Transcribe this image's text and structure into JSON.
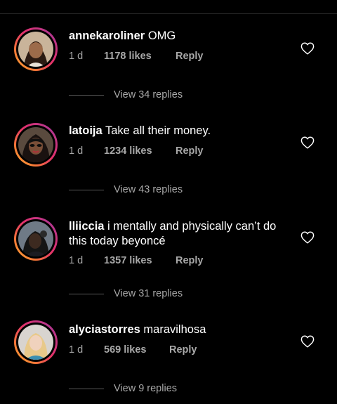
{
  "comments": [
    {
      "username": "annekaroliner",
      "text": "OMG",
      "time": "1 d",
      "likes": "1178 likes",
      "reply": "Reply",
      "view_replies": "View 34 replies"
    },
    {
      "username": "latoija",
      "text": "Take all their money.",
      "time": "1 d",
      "likes": "1234 likes",
      "reply": "Reply",
      "view_replies": "View 43 replies"
    },
    {
      "username": "lliiccia",
      "text": "i mentally and physically can’t do this today beyoncé",
      "time": "1 d",
      "likes": "1357 likes",
      "reply": "Reply",
      "view_replies": "View 31 replies"
    },
    {
      "username": "alyciastorres",
      "text": "maravilhosa",
      "time": "1 d",
      "likes": "569 likes",
      "reply": "Reply",
      "view_replies": "View 9 replies"
    }
  ],
  "icons": {
    "like": "heart-outline-icon"
  },
  "colors": {
    "background": "#000000",
    "primary_text": "#ffffff",
    "secondary_text": "#a8a8a8",
    "story_ring": [
      "#f9b233",
      "#e1306c",
      "#833ab4"
    ]
  }
}
